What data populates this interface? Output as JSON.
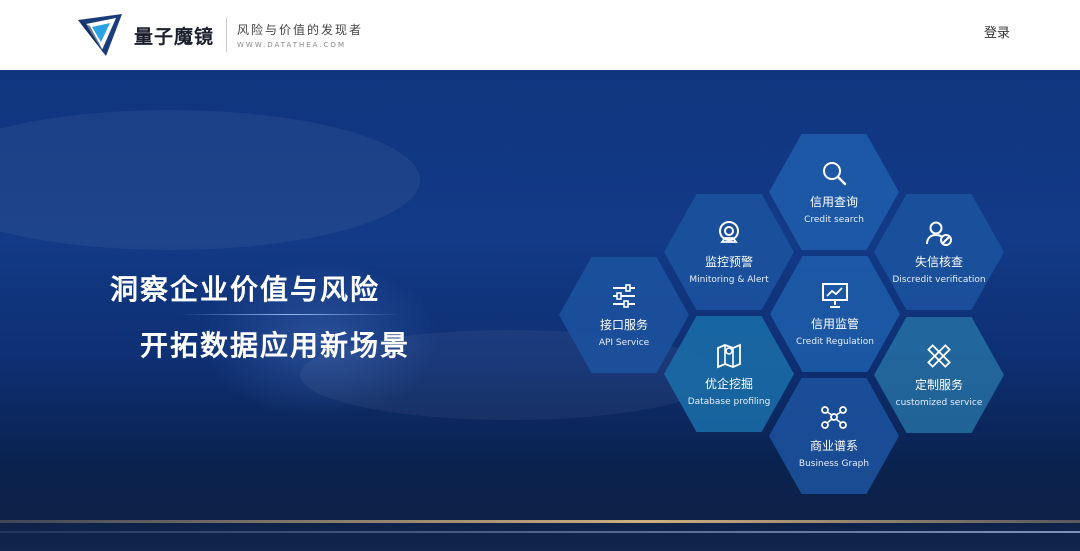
{
  "header": {
    "brand_name": "量子魔镜",
    "slogan": "风险与价值的发现者",
    "url": "WWW.DATATHEA.COM",
    "login_label": "登录"
  },
  "hero": {
    "headline_1": "洞察企业价值与风险",
    "headline_2": "开拓数据应用新场景"
  },
  "services": [
    {
      "zh": "信用查询",
      "en": "Credit search",
      "icon": "search-icon"
    },
    {
      "zh": "监控预警",
      "en": "Minitoring & Alert",
      "icon": "camera-icon"
    },
    {
      "zh": "失信核查",
      "en": "Discredit verification",
      "icon": "user-block-icon"
    },
    {
      "zh": "接口服务",
      "en": "API Service",
      "icon": "sliders-icon"
    },
    {
      "zh": "信用监管",
      "en": "Credit Regulation",
      "icon": "presentation-icon"
    },
    {
      "zh": "优企挖掘",
      "en": "Database profiling",
      "icon": "map-pin-icon"
    },
    {
      "zh": "定制服务",
      "en": "customized service",
      "icon": "ruler-pencil-icon"
    },
    {
      "zh": "商业谱系",
      "en": "Business Graph",
      "icon": "network-icon"
    }
  ],
  "colors": {
    "hero_bg": "#123a86",
    "hex_blue": "#1e5caa",
    "hex_teal": "#2878aa"
  }
}
